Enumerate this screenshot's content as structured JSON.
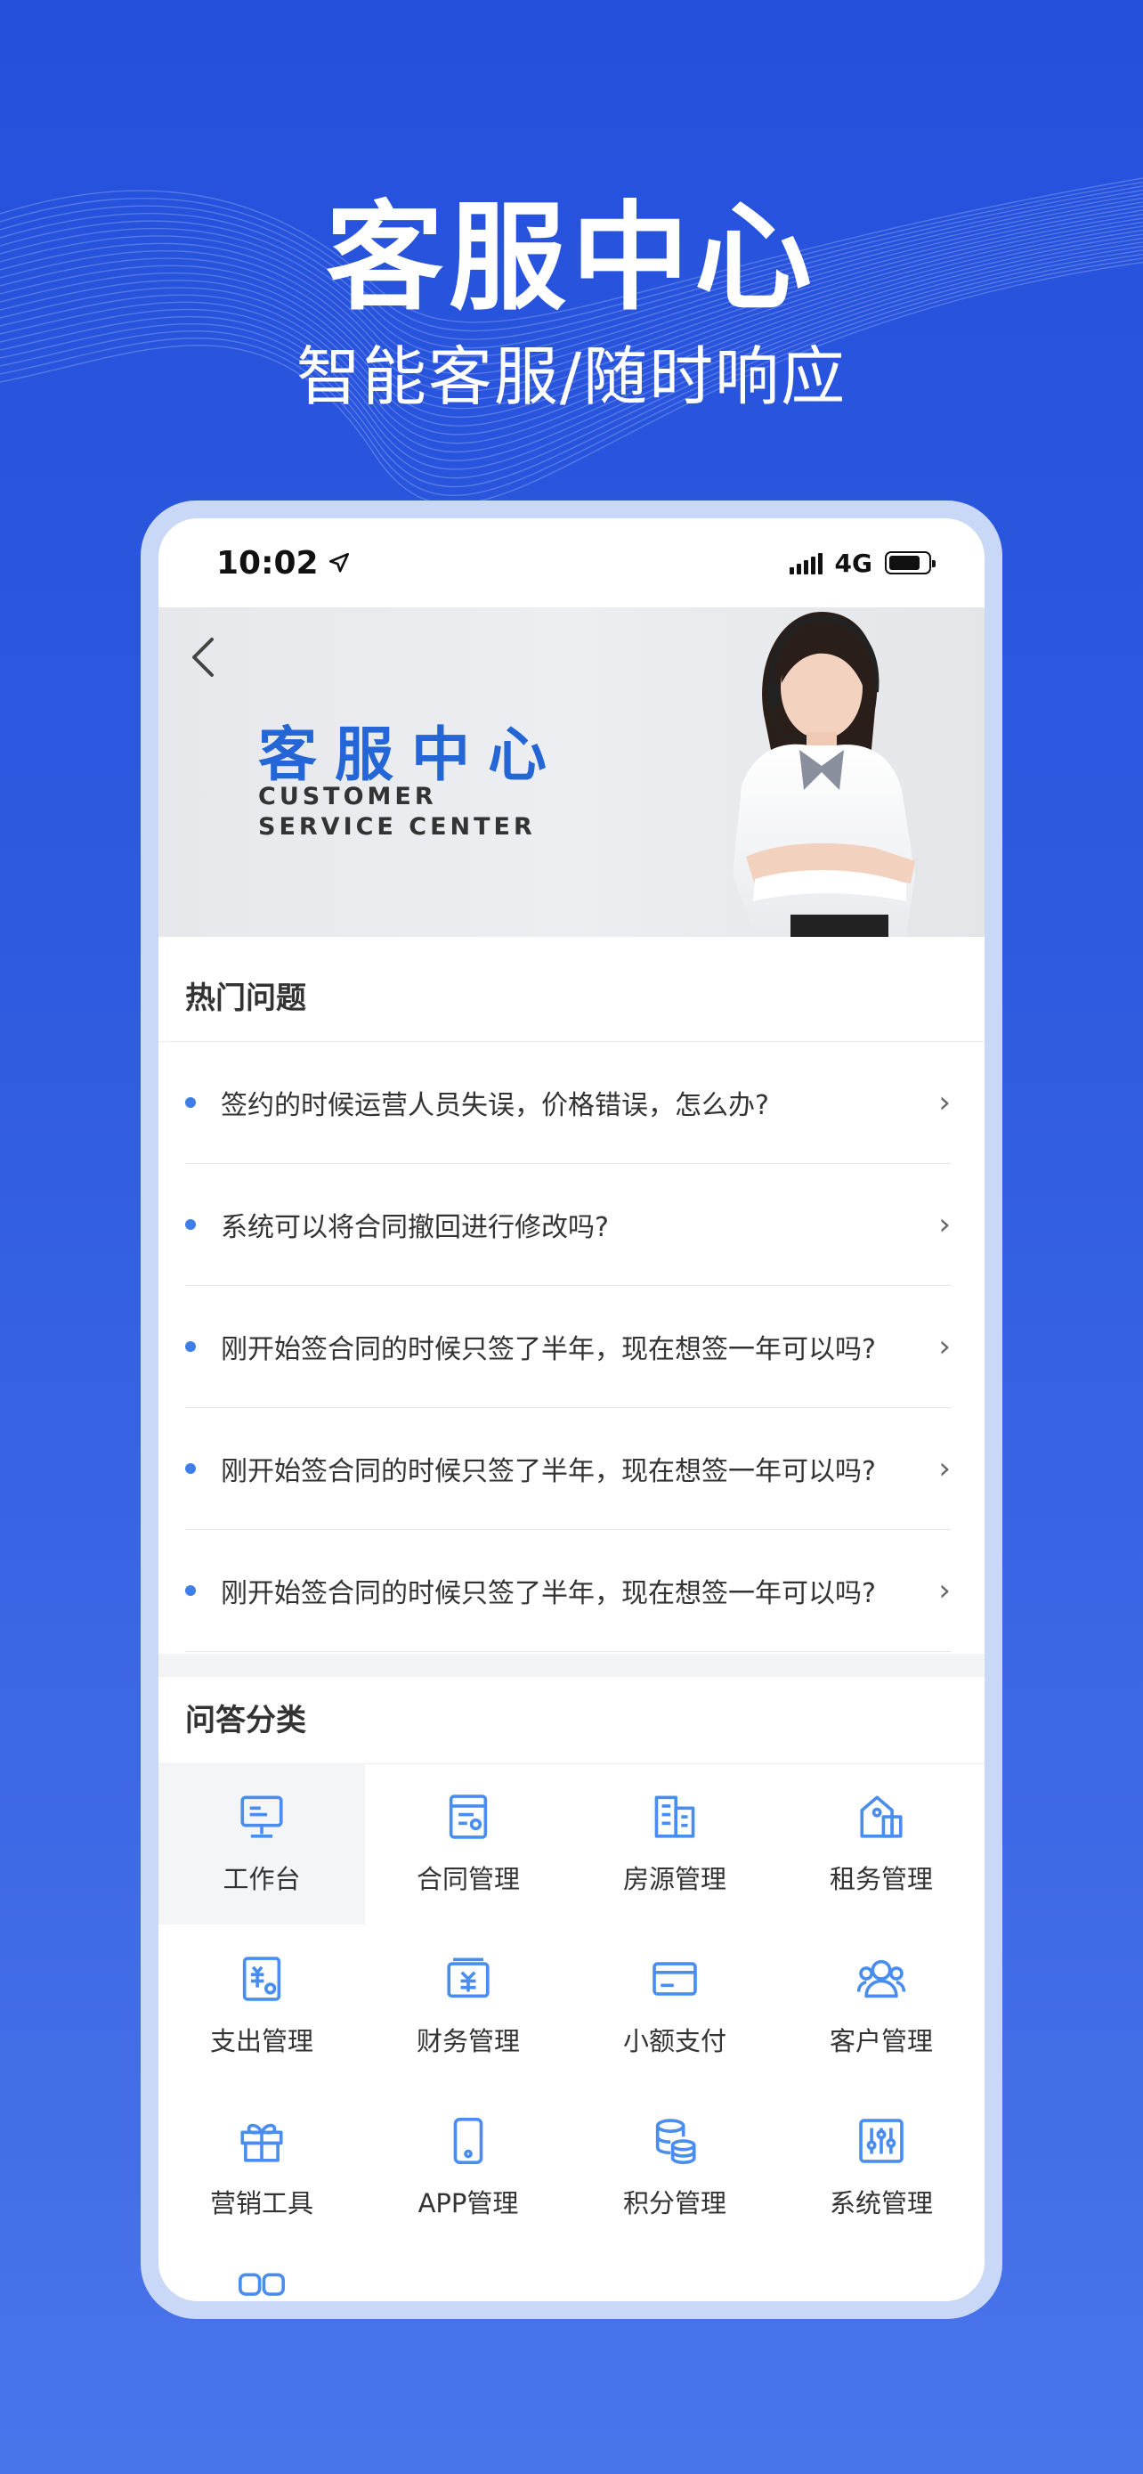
{
  "promo": {
    "title": "客服中心",
    "subtitle": "智能客服/随时响应"
  },
  "status_bar": {
    "time": "10:02",
    "network": "4G"
  },
  "banner": {
    "title_cn": "客服中心",
    "title_en": "CUSTOMER SERVICE CENTER"
  },
  "hot_questions": {
    "title": "热门问题",
    "items": [
      {
        "text": "签约的时候运营人员失误，价格错误，怎么办?"
      },
      {
        "text": "系统可以将合同撤回进行修改吗?"
      },
      {
        "text": "刚开始签合同的时候只签了半年，现在想签一年可以吗?"
      },
      {
        "text": "刚开始签合同的时候只签了半年，现在想签一年可以吗?"
      },
      {
        "text": "刚开始签合同的时候只签了半年，现在想签一年可以吗?"
      }
    ]
  },
  "categories": {
    "title": "问答分类",
    "items": [
      {
        "label": "工作台",
        "icon": "workbench-icon"
      },
      {
        "label": "合同管理",
        "icon": "contract-icon"
      },
      {
        "label": "房源管理",
        "icon": "building-icon"
      },
      {
        "label": "租务管理",
        "icon": "rental-icon"
      },
      {
        "label": "支出管理",
        "icon": "expense-icon"
      },
      {
        "label": "财务管理",
        "icon": "finance-icon"
      },
      {
        "label": "小额支付",
        "icon": "card-icon"
      },
      {
        "label": "客户管理",
        "icon": "customers-icon"
      },
      {
        "label": "营销工具",
        "icon": "gift-icon"
      },
      {
        "label": "APP管理",
        "icon": "phone-icon"
      },
      {
        "label": "积分管理",
        "icon": "points-icon"
      },
      {
        "label": "系统管理",
        "icon": "settings-sliders-icon"
      }
    ]
  },
  "colors": {
    "accent": "#3f7ee8",
    "icon_blue": "#4a8df0",
    "background_blue": "#2450dc"
  }
}
